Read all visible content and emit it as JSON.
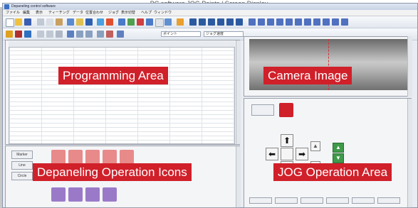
{
  "caption": "PC software JOG Points / Screen Display",
  "window": {
    "title": "Depaneling control software",
    "menu": [
      "ファイル",
      "編集",
      "表示",
      "ティーチング",
      "データ",
      "位置合わせ",
      "ジョグ",
      "表示切替",
      "ヘルプ",
      "ウィンドウ"
    ]
  },
  "toolbar": {
    "combo_1": "ポイント",
    "combo_2": "ジョグ速度"
  },
  "labels": {
    "programming_area": "Programming Area",
    "camera_image": "Camera Image",
    "depaneling_icons": "Depaneling  Operation Icons",
    "jog_area": "JOG Operation Area"
  },
  "side_buttons": [
    "Marker",
    "Line",
    "Circle"
  ],
  "jog": {
    "up": "⬆",
    "down": "⬇",
    "left": "⬅",
    "right": "➡",
    "z_up": "▲",
    "z_down": "▼"
  },
  "colors": {
    "highlight": "#d0202a",
    "green": "#3f9a4a"
  }
}
